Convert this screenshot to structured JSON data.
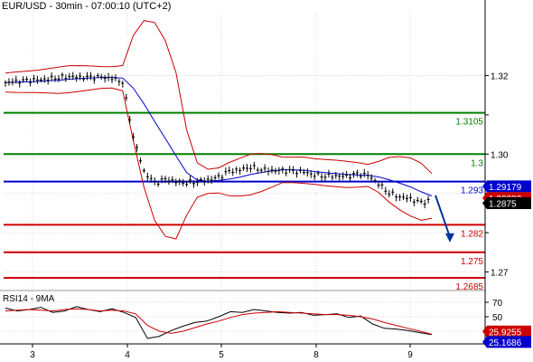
{
  "header": {
    "title": "EUR/USD - 30min - 07:00:10 (UTC+2)"
  },
  "colors": {
    "resistance": "#008000",
    "pivot": "#0000cc",
    "support": "#cc0000",
    "bollinger": "#cc0000",
    "moving_average": "#0000cc",
    "candles": "#000000",
    "rsi_line": "#000000",
    "rsi_signal": "#cc0000",
    "arrow": "#003399",
    "grid": "#d8d8d8"
  },
  "chart_data": [
    {
      "type": "candlestick",
      "title": "EUR/USD - 30min - 07:00:10 (UTC+2)",
      "x_tick_labels": [
        "3",
        "4",
        "5",
        "8",
        "9"
      ],
      "y_ticks": [
        1.27,
        1.28,
        1.29,
        1.3,
        1.31,
        1.32
      ],
      "y_tick_labels": [
        "1.27",
        "",
        "1.29",
        "1.30",
        "",
        "1.32"
      ],
      "ylim": [
        1.2655,
        1.336
      ],
      "levels": [
        {
          "value": 1.3105,
          "label": "1.3105",
          "role": "resistance"
        },
        {
          "value": 1.3,
          "label": "1.3",
          "role": "resistance"
        },
        {
          "value": 1.293,
          "label": "1.293",
          "role": "pivot"
        },
        {
          "value": 1.282,
          "label": "1.282",
          "role": "support"
        },
        {
          "value": 1.275,
          "label": "1.275",
          "role": "support"
        },
        {
          "value": 1.2685,
          "label": "1.2685",
          "role": "support"
        }
      ],
      "price_badges": [
        {
          "value": 1.29179,
          "label": "1.29179",
          "style": "blue"
        },
        {
          "value": 1.28882,
          "label": "1.28882",
          "style": "red"
        },
        {
          "value": 1.2875,
          "label": "1.2875",
          "style": "black"
        }
      ],
      "close_series": [
        1.3182,
        1.3184,
        1.3186,
        1.3188,
        1.3192,
        1.3196,
        1.3198,
        1.3195,
        1.3194,
        1.3195,
        1.3193,
        1.3185,
        1.3045,
        1.2955,
        1.2925,
        1.2935,
        1.293,
        1.2928,
        1.2931,
        1.2934,
        1.294,
        1.2955,
        1.296,
        1.2968,
        1.2962,
        1.2958,
        1.2957,
        1.2955,
        1.2954,
        1.2948,
        1.2945,
        1.2945,
        1.2942,
        1.2948,
        1.2946,
        1.2925,
        1.2902,
        1.2892,
        1.2885,
        1.2875,
        1.2882
      ],
      "projection": {
        "from": 1.2895,
        "to": 1.2775
      }
    },
    {
      "type": "line",
      "title": "RSI14 - 9MA",
      "y_ticks": [
        30,
        50,
        70
      ],
      "ylim": [
        15,
        85
      ],
      "series": [
        {
          "role": "rsi",
          "values": [
            62,
            58,
            60,
            63,
            56,
            58,
            64,
            60,
            57,
            61,
            56,
            49,
            20,
            23,
            31,
            37,
            42,
            44,
            50,
            57,
            56,
            60,
            58,
            56,
            55,
            56,
            52,
            53,
            54,
            49,
            51,
            40,
            34,
            33,
            31,
            28,
            25.2
          ]
        },
        {
          "role": "ma",
          "values": [
            58,
            59,
            60,
            59,
            58,
            60,
            61,
            60,
            58,
            59,
            58,
            54,
            38,
            30,
            27,
            30,
            35,
            40,
            44,
            49,
            53,
            55,
            56,
            57,
            56,
            55,
            54,
            53,
            53,
            52,
            50,
            47,
            42,
            38,
            34,
            30,
            25.9
          ]
        }
      ],
      "value_badges": [
        {
          "value": 25.9255,
          "label": "25.9255",
          "style": "red"
        },
        {
          "value": 25.1686,
          "label": "25.1686",
          "style": "blue"
        }
      ]
    }
  ]
}
